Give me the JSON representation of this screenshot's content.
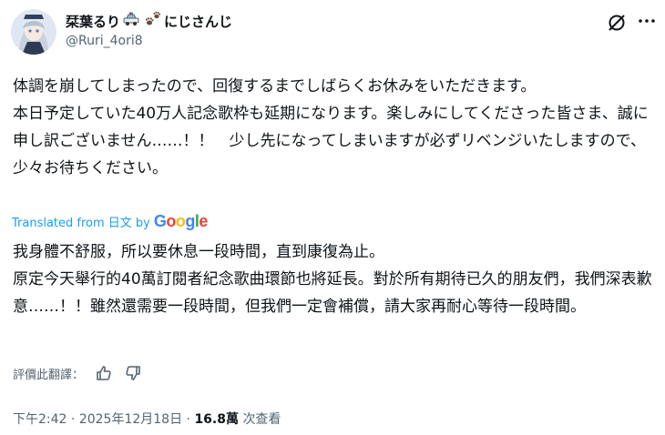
{
  "author": {
    "display_name": "栞葉るり",
    "display_name_suffix": "にじさんじ",
    "badge_icons": [
      "police-car-icon",
      "paw-prints-icon"
    ],
    "handle": "@Ruri_4ori8",
    "avatar": "avatar-portrait"
  },
  "header_icons": [
    "grok-icon",
    "more-options-icon"
  ],
  "tweet": {
    "original_text": "体調を崩してしまったので、回復するまでしばらくお休みをいただきます。\n本日予定していた40万人記念歌枠も延期になります。楽しみにしてくださった皆さま、誠に申し訳ございません……！！　少し先になってしまいますが必ずリベンジいたしますので、少々お待ちください。",
    "translated_from": "Translated from 日文 by",
    "translation_provider": "Google",
    "translated_text": "我身體不舒服，所以要休息一段時間，直到康復為止。\n原定今天舉行的40萬訂閱者紀念歌曲環節也將延長。對於所有期待已久的朋友們，我們深表歉意……！！雖然還需要一段時間，但我們一定會補償，請大家再耐心等待一段時間。"
  },
  "rating": {
    "label": "評價此翻譯：",
    "icons": [
      "thumbs-up-icon",
      "thumbs-down-icon"
    ]
  },
  "meta": {
    "time": "下午2:42",
    "separator": "·",
    "date": "2025年12月18日",
    "views": "16.8萬",
    "views_label": "次查看"
  },
  "colors": {
    "link_blue": "#1d9bf0",
    "secondary_text": "#536471",
    "primary_text": "#0f1419"
  }
}
